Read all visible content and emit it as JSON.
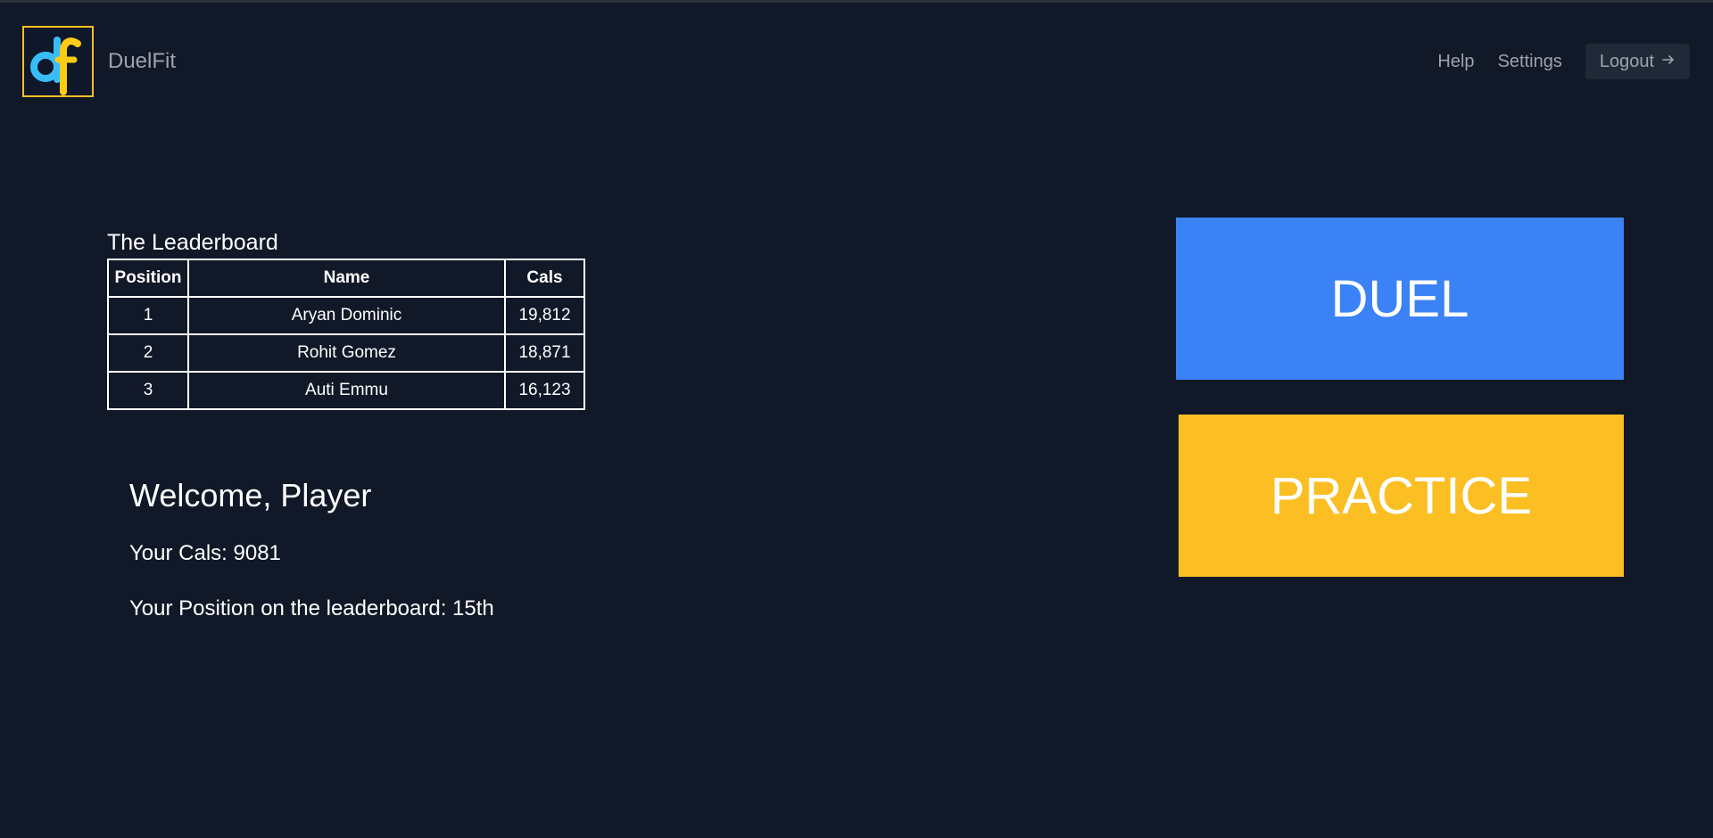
{
  "brand": {
    "name": "DuelFit",
    "logo_text": "df",
    "logo_icon": "df-logo-icon"
  },
  "nav": {
    "help": "Help",
    "settings": "Settings",
    "logout": "Logout",
    "logout_icon": "arrow-right-icon"
  },
  "leaderboard": {
    "title": "The Leaderboard",
    "columns": [
      "Position",
      "Name",
      "Cals"
    ],
    "rows": [
      {
        "position": "1",
        "name": "Aryan Dominic",
        "cals": "19,812"
      },
      {
        "position": "2",
        "name": "Rohit Gomez",
        "cals": "18,871"
      },
      {
        "position": "3",
        "name": "Auti Emmu",
        "cals": "16,123"
      }
    ]
  },
  "welcome": {
    "title": "Welcome, Player",
    "cals": "Your Cals: 9081",
    "position": "Your Position on the leaderboard: 15th"
  },
  "actions": {
    "duel": "DUEL",
    "practice": "PRACTICE"
  },
  "colors": {
    "background": "#111827",
    "duel": "#3b82f6",
    "practice": "#fbbf24",
    "muted_text": "#9ca3af",
    "logout_bg": "#1f2937"
  }
}
